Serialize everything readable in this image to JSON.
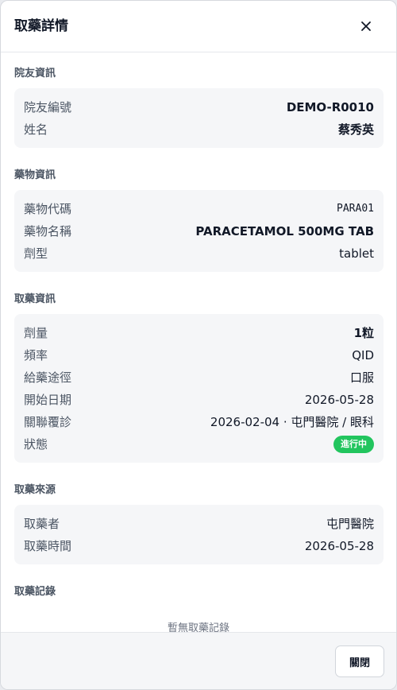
{
  "dialog": {
    "title": "取藥詳情",
    "close_icon": "close-icon",
    "footer_close_label": "關閉"
  },
  "resident": {
    "section_title": "院友資訊",
    "id_label": "院友編號",
    "id_value": "DEMO-R0010",
    "name_label": "姓名",
    "name_value": "蔡秀英"
  },
  "medication": {
    "section_title": "藥物資訊",
    "code_label": "藥物代碼",
    "code_value": "PARA01",
    "name_label": "藥物名稱",
    "name_value": "PARACETAMOL 500MG TAB",
    "form_label": "劑型",
    "form_value": "tablet"
  },
  "dispense": {
    "section_title": "取藥資訊",
    "dose_label": "劑量",
    "dose_value": "1粒",
    "freq_label": "頻率",
    "freq_value": "QID",
    "route_label": "給藥途徑",
    "route_value": "口服",
    "start_label": "開始日期",
    "start_value": "2026-05-28",
    "followup_label": "關聯覆診",
    "followup_value": "2026-02-04 · 屯門醫院 / 眼科",
    "status_label": "狀態",
    "status_value": "進行中",
    "status_color": "#22c55e"
  },
  "source": {
    "section_title": "取藥來源",
    "by_label": "取藥者",
    "by_value": "屯門醫院",
    "time_label": "取藥時間",
    "time_value": "2026-05-28"
  },
  "records": {
    "section_title": "取藥記錄",
    "empty_text": "暫無取藥記錄"
  }
}
